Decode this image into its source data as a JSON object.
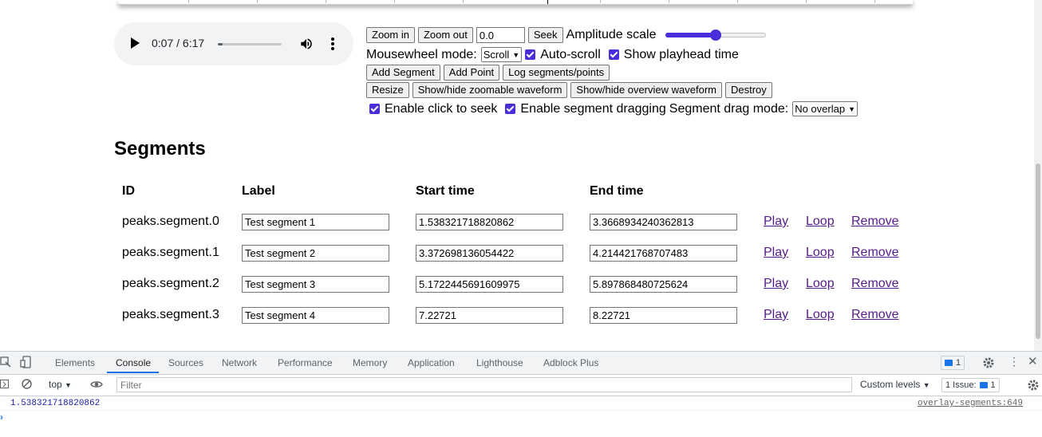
{
  "player": {
    "time": "0:07 / 6:17",
    "progress": 0.02
  },
  "controls": {
    "zoom_in": "Zoom in",
    "zoom_out": "Zoom out",
    "seek_value": "0.0",
    "seek": "Seek",
    "amplitude_label": "Amplitude scale",
    "amplitude_value": 0.5,
    "mousewheel_label": "Mousewheel mode:",
    "mousewheel_value": "Scroll",
    "auto_scroll": "Auto-scroll",
    "show_playhead": "Show playhead time",
    "add_segment": "Add Segment",
    "add_point": "Add Point",
    "log": "Log segments/points",
    "resize": "Resize",
    "toggle_zoomable": "Show/hide zoomable waveform",
    "toggle_overview": "Show/hide overview waveform",
    "destroy": "Destroy",
    "click_to_seek": "Enable click to seek",
    "segment_dragging": "Enable segment dragging",
    "drag_mode_label": "Segment drag mode:",
    "drag_mode_value": "No overlap"
  },
  "segments": {
    "title": "Segments",
    "headers": {
      "id": "ID",
      "label": "Label",
      "start": "Start time",
      "end": "End time"
    },
    "rows": [
      {
        "id": "peaks.segment.0",
        "label": "Test segment 1",
        "start": "1.538321718820862",
        "end": "3.3668934240362813"
      },
      {
        "id": "peaks.segment.1",
        "label": "Test segment 2",
        "start": "3.372698136054422",
        "end": "4.21442176870748​3"
      },
      {
        "id": "peaks.segment.2",
        "label": "Test segment 3",
        "start": "5.1722445691609975",
        "end": "5.897868480725624"
      },
      {
        "id": "peaks.segment.3",
        "label": "Test segment 4",
        "start": "7.22721",
        "end": "8.22721"
      }
    ],
    "play": "Play",
    "loop": "Loop",
    "remove": "Remove"
  },
  "devtools": {
    "tabs": [
      "Elements",
      "Console",
      "Sources",
      "Network",
      "Performance",
      "Memory",
      "Application",
      "Lighthouse",
      "Adblock Plus"
    ],
    "active_tab": "Console",
    "messages_badge": "1",
    "context": "top",
    "filter_placeholder": "Filter",
    "levels": "Custom levels",
    "issues_label": "1 Issue:",
    "issues_count": "1",
    "log_value": "1.538321718820862",
    "log_source": "overlay-segments:649",
    "accent": "#1a73e8"
  }
}
